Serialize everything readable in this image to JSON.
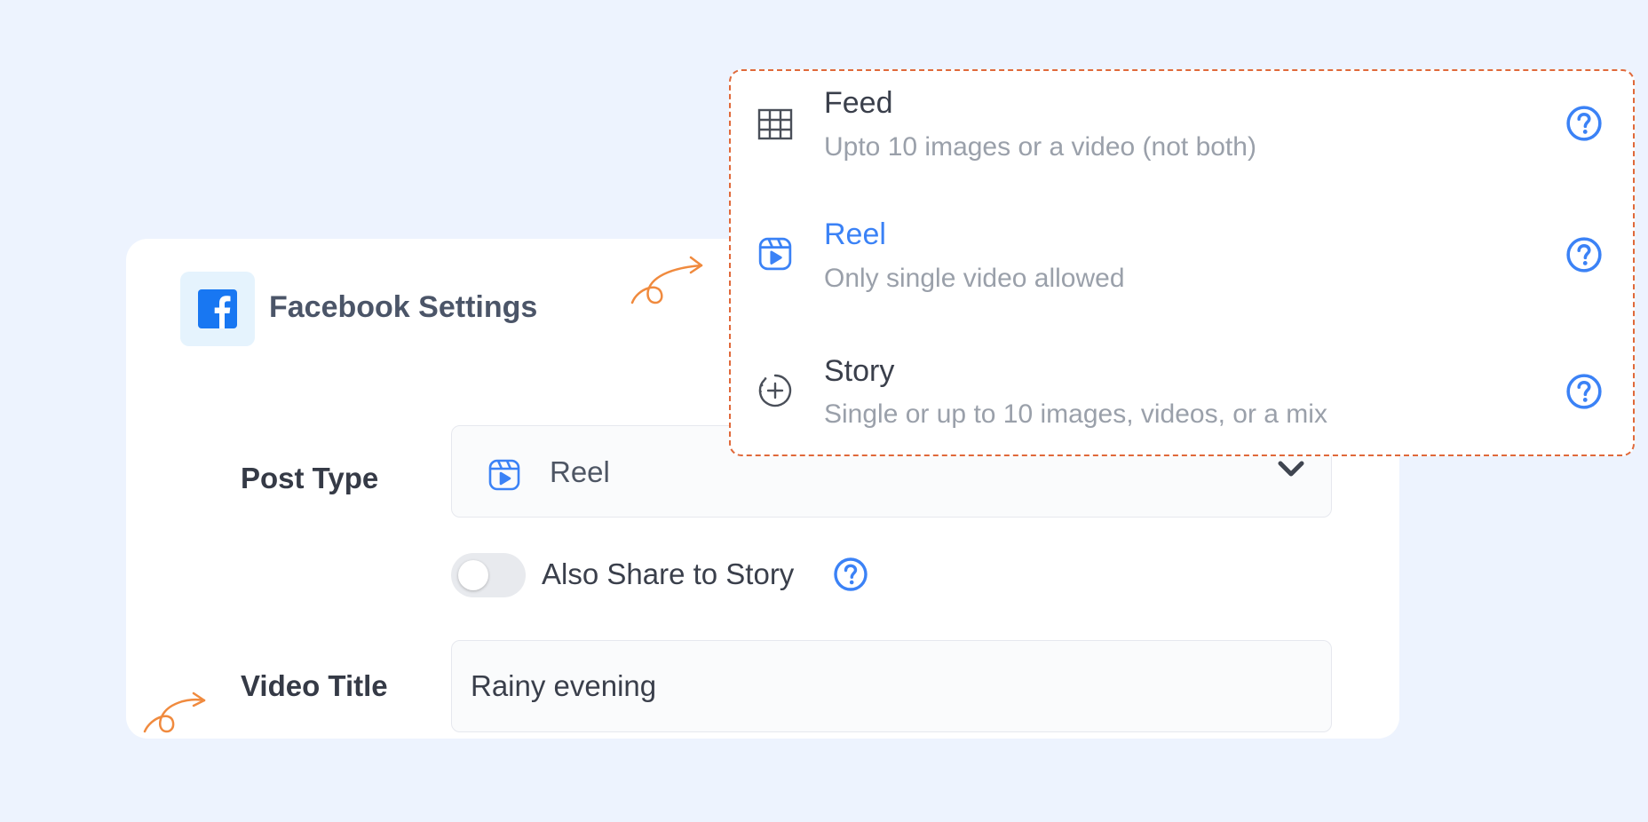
{
  "colors": {
    "accent": "#3b82f6",
    "facebook": "#1877f2",
    "background": "#edf3fe",
    "annotation": "#f08a3e"
  },
  "card": {
    "logo_icon": "facebook-icon",
    "title": "Facebook Settings",
    "post_type_label": "Post Type",
    "post_type_value": "Reel",
    "post_type_icon": "reel-icon",
    "toggle_label": "Also Share to Story",
    "toggle_on": false,
    "video_title_label": "Video Title",
    "video_title_value": "Rainy evening"
  },
  "dropdown": {
    "options": [
      {
        "icon": "grid-icon",
        "title": "Feed",
        "subtitle": "Upto 10 images or a video (not both)",
        "selected": false
      },
      {
        "icon": "reel-icon",
        "title": "Reel",
        "subtitle": "Only single video allowed",
        "selected": true
      },
      {
        "icon": "story-add-icon",
        "title": "Story",
        "subtitle": "Single or up to 10 images, videos, or a mix",
        "selected": false
      }
    ]
  }
}
